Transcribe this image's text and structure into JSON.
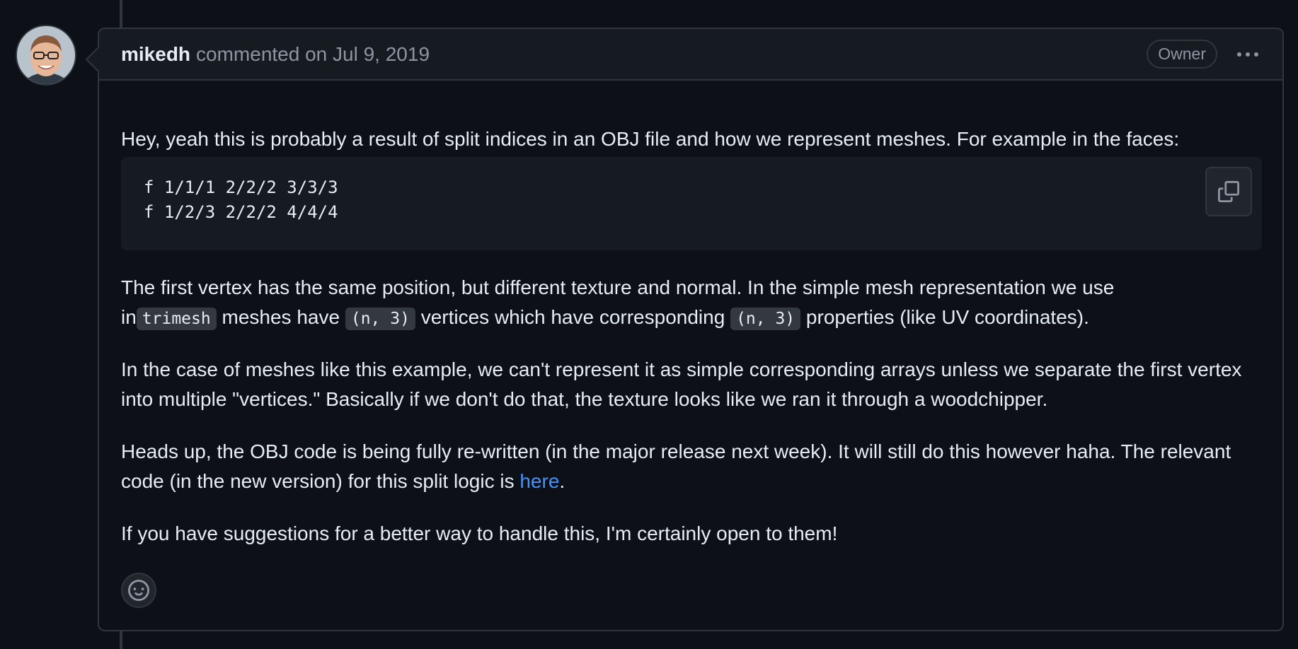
{
  "comment": {
    "author": "mikedh",
    "action": "commented on Jul 9, 2019",
    "role_badge": "Owner",
    "more_options_icon": "kebab-horizontal-icon",
    "paragraph1": "Hey, yeah this is probably a result of split indices in an OBJ file and how we represent meshes. For example in the faces:",
    "code_lines": [
      "f 1/1/1 2/2/2 3/3/3",
      "f 1/2/3 2/2/2 4/4/4"
    ],
    "copy_icon": "copy-icon",
    "paragraph2": {
      "line1": "The first vertex has the same position, but different texture and normal. In the simple mesh representation we use",
      "pre_code1": "in",
      "code1": "trimesh",
      "mid1": " meshes have ",
      "code2": "(n, 3)",
      "mid2": " vertices which have corresponding ",
      "code3": "(n, 3)",
      "post": " properties (like UV coordinates)."
    },
    "paragraph3": "In the case of meshes like this example, we can't represent it as simple corresponding arrays unless we separate the first vertex into multiple \"vertices.\" Basically if we don't do that, the texture looks like we ran it through a woodchipper.",
    "paragraph4": {
      "text_before": "Heads up, the OBJ code is being fully re-written (in the major release next week). It will still do this however haha. The relevant code (in the new version) for this split logic is ",
      "link": "here",
      "text_after": "."
    },
    "paragraph5": "If you have suggestions for a better way to handle this, I'm certainly open to them!",
    "reaction_icon": "smiley-icon"
  },
  "colors": {
    "background": "#0d1117",
    "header_bg": "#161b22",
    "border": "#30363d",
    "text": "#e6edf3",
    "muted": "#8d96a0",
    "link": "#4493f8"
  }
}
